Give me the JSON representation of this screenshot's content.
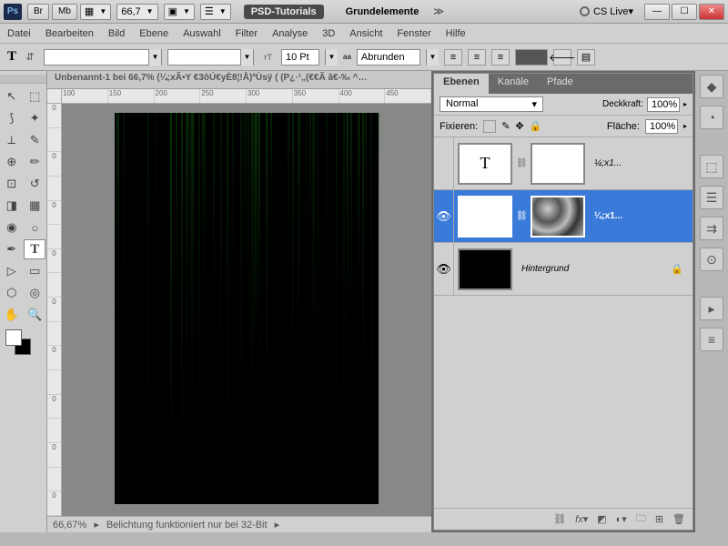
{
  "titlebar": {
    "br": "Br",
    "mb": "Mb",
    "zoom": "66,7",
    "w1": "PSD-Tutorials",
    "w2": "Grundelemente",
    "cslive": "CS Live"
  },
  "menu": [
    "Datei",
    "Bearbeiten",
    "Bild",
    "Ebene",
    "Auswahl",
    "Filter",
    "Analyse",
    "3D",
    "Ansicht",
    "Fenster",
    "Hilfe"
  ],
  "optbar": {
    "size": "10 Pt",
    "aa_label": "aa",
    "aa": "Abrunden"
  },
  "doc_tab": "Unbenannt-1 bei 66,7% (¼;xÃ•Y €3ôÚ€yÈ8¦!Å)ªÙsÿ       (  (P¿·¹„(€€Ã â€-‰ ^…",
  "ruler_h": [
    "100",
    "150",
    "200",
    "250",
    "300",
    "350",
    "400",
    "450"
  ],
  "ruler_v": [
    "0",
    "",
    "0",
    "",
    "0",
    "",
    "0",
    "",
    "0",
    "",
    "0",
    "",
    "0",
    "",
    "0",
    "",
    "0"
  ],
  "status": {
    "zoom": "66,67%",
    "msg": "Belichtung funktioniert nur bei 32-Bit"
  },
  "panel": {
    "tabs": [
      "Ebenen",
      "Kanäle",
      "Pfade"
    ],
    "blend": "Normal",
    "opacity_lbl": "Deckkraft:",
    "opacity": "100%",
    "lock_lbl": "Fixieren:",
    "fill_lbl": "Fläche:",
    "fill": "100%",
    "layers": [
      {
        "name": "¼;x1...",
        "type": "T",
        "visible": false,
        "mask": false,
        "sel": false
      },
      {
        "name": "¼;x1...",
        "type": "T",
        "visible": true,
        "mask": true,
        "sel": true
      },
      {
        "name": "Hintergrund",
        "type": "bg",
        "visible": true,
        "mask": false,
        "sel": false,
        "locked": true
      }
    ]
  }
}
